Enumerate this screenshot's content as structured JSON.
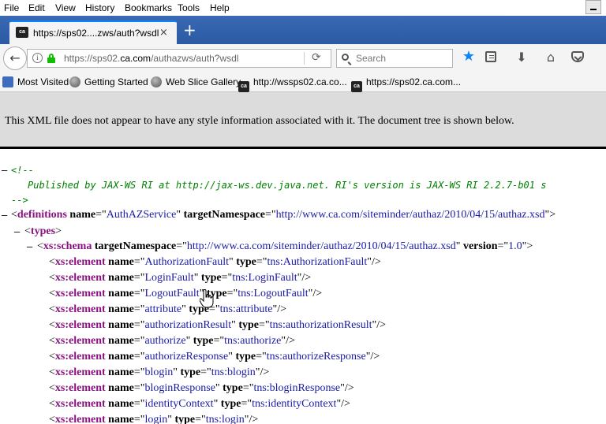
{
  "menu": [
    "File",
    "Edit",
    "View",
    "History",
    "Bookmarks",
    "Tools",
    "Help"
  ],
  "tab": {
    "title": "https://sps02....zws/auth?wsdl",
    "favicon_text": "ca",
    "close_glyph": "×",
    "new_tab_glyph": "+"
  },
  "navbar": {
    "url_prefix": "https://sps02.",
    "url_domain": "ca.com",
    "url_suffix": "/authazws/auth?wsdl",
    "search_placeholder": "Search"
  },
  "bookmarks": [
    {
      "label": "Most Visited",
      "icon": "folder-icon"
    },
    {
      "label": "Getting Started",
      "icon": "globe-icon"
    },
    {
      "label": "Web Slice Gallery",
      "icon": "globe-icon"
    },
    {
      "label": "http://wssps02.ca.co...",
      "icon": "ca-logo-icon"
    },
    {
      "label": "https://sps02.ca.com...",
      "icon": "ca-logo-icon"
    }
  ],
  "info_banner": "This XML file does not appear to have any style information associated with it. The document tree is shown below.",
  "xml": {
    "comment_open": "<!--",
    "comment_body": "Published by JAX-WS RI at http://jax-ws.dev.java.net. RI's version is JAX-WS RI 2.2.7-b01  s",
    "comment_close": "-->",
    "definitions": {
      "tag": "definitions",
      "name_attr": "name",
      "name_val": "AuthAZService",
      "ns_attr": "targetNamespace",
      "ns_val": "http://www.ca.com/siteminder/authaz/2010/04/15/authaz.xsd"
    },
    "types_tag": "types",
    "schema": {
      "tag": "xs:schema",
      "ns_attr": "targetNamespace",
      "ns_val": "http://www.ca.com/siteminder/authaz/2010/04/15/authaz.xsd",
      "version_attr": "version",
      "version_val": "1.0"
    },
    "elements": [
      {
        "name": "AuthorizationFault",
        "type": "tns:AuthorizationFault"
      },
      {
        "name": "LoginFault",
        "type": "tns:LoginFault"
      },
      {
        "name": "LogoutFault",
        "type": "tns:LogoutFault"
      },
      {
        "name": "attribute",
        "type": "tns:attribute"
      },
      {
        "name": "authorizationResult",
        "type": "tns:authorizationResult"
      },
      {
        "name": "authorize",
        "type": "tns:authorize"
      },
      {
        "name": "authorizeResponse",
        "type": "tns:authorizeResponse"
      },
      {
        "name": "blogin",
        "type": "tns:blogin"
      },
      {
        "name": "bloginResponse",
        "type": "tns:bloginResponse"
      },
      {
        "name": "identityContext",
        "type": "tns:identityContext"
      },
      {
        "name": "login",
        "type": "tns:login"
      }
    ],
    "element_tag": "xs:element",
    "name_attr": "name",
    "type_attr": "type"
  },
  "colors": {
    "tag": "#881280",
    "value": "#1a1aa6",
    "comment": "#008000",
    "tabstrip": "#2f5fa8",
    "accent": "#0a84ff"
  }
}
